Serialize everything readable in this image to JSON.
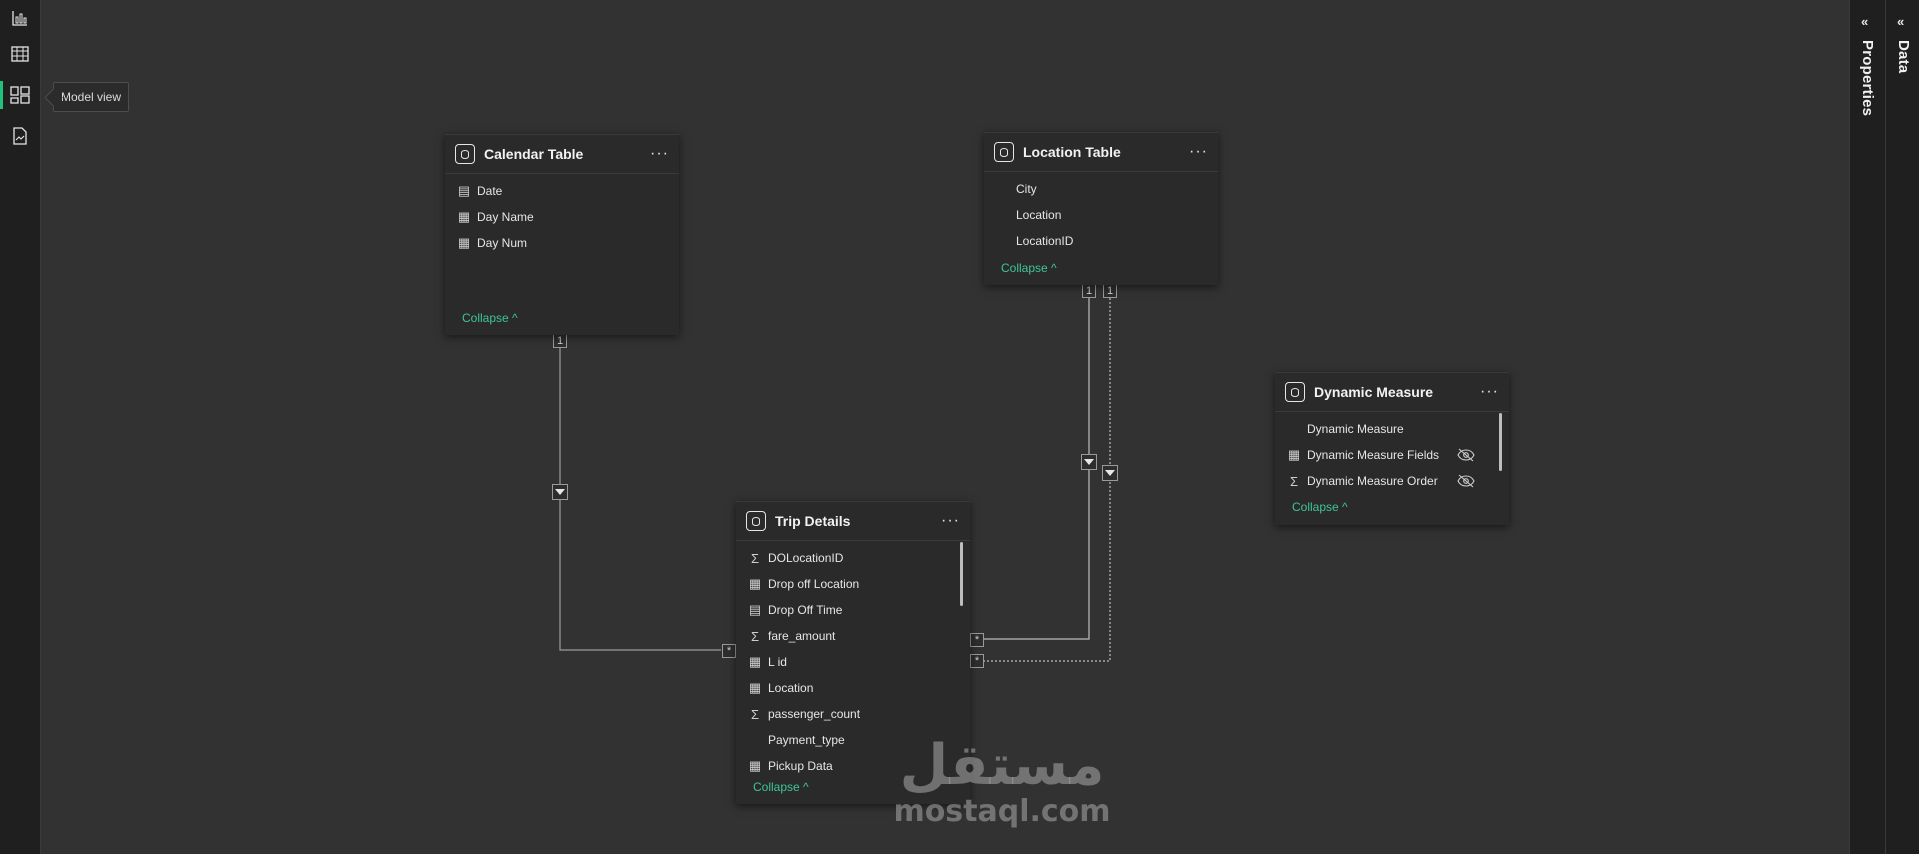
{
  "left_rail": {
    "items": [
      {
        "name": "report-view",
        "icon": "bar-chart-icon"
      },
      {
        "name": "table-view",
        "icon": "table-grid-icon"
      },
      {
        "name": "model-view",
        "icon": "model-diagram-icon",
        "active": true
      },
      {
        "name": "dax-query-view",
        "icon": "dax-query-icon"
      }
    ],
    "tooltip": "Model view"
  },
  "right_panels": {
    "properties_label": "Properties",
    "data_label": "Data",
    "chevron": "«"
  },
  "tables": {
    "calendar": {
      "title": "Calendar Table",
      "fields": [
        {
          "label": "Date",
          "icon": "calendar-icon"
        },
        {
          "label": "Day Name",
          "icon": "calculated-column-icon"
        },
        {
          "label": "Day Num",
          "icon": "calculated-column-icon"
        }
      ],
      "collapse": "Collapse"
    },
    "location": {
      "title": "Location Table",
      "fields": [
        {
          "label": "City",
          "icon": ""
        },
        {
          "label": "Location",
          "icon": ""
        },
        {
          "label": "LocationID",
          "icon": ""
        }
      ],
      "collapse": "Collapse"
    },
    "dynamic": {
      "title": "Dynamic Measure",
      "fields": [
        {
          "label": "Dynamic Measure",
          "icon": "",
          "hidden": false
        },
        {
          "label": "Dynamic Measure Fields",
          "icon": "field-parameter-icon",
          "hidden": true
        },
        {
          "label": "Dynamic Measure Order",
          "icon": "sigma-icon",
          "hidden": true
        }
      ],
      "collapse": "Collapse"
    },
    "trip": {
      "title": "Trip Details",
      "fields": [
        {
          "label": "DOLocationID",
          "icon": "sigma-icon"
        },
        {
          "label": "Drop off Location",
          "icon": "calculated-column-icon"
        },
        {
          "label": "Drop Off Time",
          "icon": "calendar-icon"
        },
        {
          "label": "fare_amount",
          "icon": "sigma-icon"
        },
        {
          "label": "L id",
          "icon": "calculated-column-icon"
        },
        {
          "label": "Location",
          "icon": "calculated-column-icon"
        },
        {
          "label": "passenger_count",
          "icon": "sigma-icon"
        },
        {
          "label": "Payment_type",
          "icon": ""
        },
        {
          "label": "Pickup Data",
          "icon": "calculated-column-icon"
        }
      ],
      "collapse": "Collapse"
    }
  },
  "relationships": {
    "one_label": "1",
    "many_label": "*"
  },
  "watermark": {
    "arabic": "مستقل",
    "latin": "mostaql.com"
  }
}
